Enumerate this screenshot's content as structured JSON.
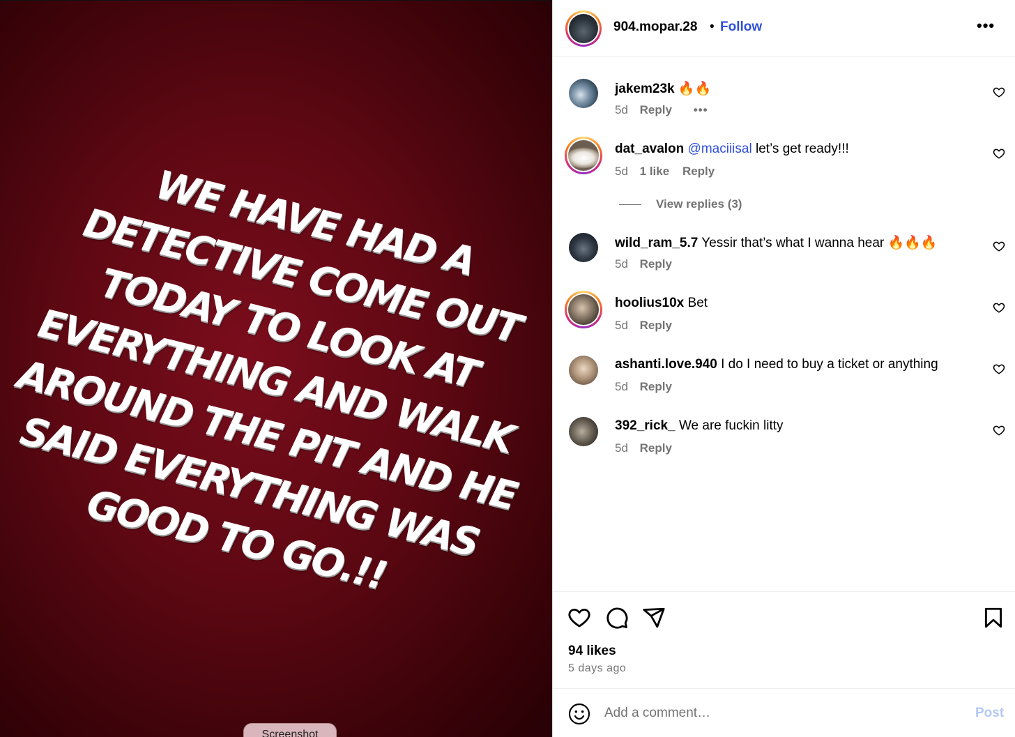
{
  "post": {
    "story_lines": [
      "We have had a",
      "detective come out",
      "today to look at",
      "everything and walk",
      "around the pit and he",
      "said everything was",
      "good to go.!!"
    ],
    "screenshot_label": "Screenshot"
  },
  "header": {
    "username": "904.mopar.28",
    "separator": "•",
    "follow_label": "Follow",
    "more_label": "•••"
  },
  "comments": [
    {
      "user": "jakem23k",
      "mention": "",
      "text": "🔥🔥",
      "time": "5d",
      "likes": "",
      "reply": "Reply",
      "more": "•••"
    },
    {
      "user": "dat_avalon",
      "mention": "@maciiisal",
      "text": "let’s get ready!!!",
      "time": "5d",
      "likes": "1 like",
      "reply": "Reply",
      "more": ""
    },
    {
      "user": "wild_ram_5.7",
      "mention": "",
      "text": "Yessir that’s what I wanna hear 🔥🔥🔥",
      "time": "5d",
      "likes": "",
      "reply": "Reply",
      "more": ""
    },
    {
      "user": "hoolius10x",
      "mention": "",
      "text": "Bet",
      "time": "5d",
      "likes": "",
      "reply": "Reply",
      "more": ""
    },
    {
      "user": "ashanti.love.940",
      "mention": "",
      "text": "I do I need to buy a ticket or anything",
      "time": "5d",
      "likes": "",
      "reply": "Reply",
      "more": ""
    },
    {
      "user": "392_rick_",
      "mention": "",
      "text": "We are fuckin litty",
      "time": "5d",
      "likes": "",
      "reply": "Reply",
      "more": ""
    }
  ],
  "view_replies_label": "View replies (3)",
  "actions": {
    "icons": [
      "heart-icon",
      "comment-icon",
      "share-icon",
      "bookmark-icon"
    ],
    "likes_label": "94 likes",
    "posted_label": "5 days ago"
  },
  "compose": {
    "placeholder": "Add a comment…",
    "post_label": "Post"
  },
  "colors": {
    "link_blue": "#2f4fd8",
    "muted": "#737373",
    "post_disabled": "#b3c8f5",
    "story_bg": "#5e0813"
  }
}
